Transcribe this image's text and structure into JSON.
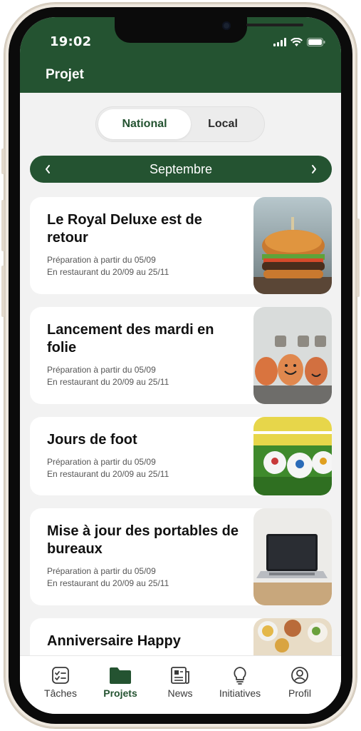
{
  "status_bar": {
    "time": "19:02"
  },
  "header": {
    "title": "Projet"
  },
  "segmented": {
    "options": [
      "National",
      "Local"
    ],
    "selected": "National"
  },
  "month_nav": {
    "label": "Septembre",
    "prev": "‹",
    "next": "›"
  },
  "projects": [
    {
      "title": "Le Royal Deluxe est de retour",
      "prep": "Préparation à partir du 05/09",
      "dates": "En restaurant du 20/09 au 25/11",
      "image": "burger-image"
    },
    {
      "title": "Lancement des mardi en folie",
      "prep": "Préparation à partir du 05/09",
      "dates": "En restaurant du 20/09 au 25/11",
      "image": "eggs-image"
    },
    {
      "title": "Jours de foot",
      "prep": "Préparation à partir du 05/09",
      "dates": "En restaurant du 20/09 au 25/11",
      "image": "footballs-image"
    },
    {
      "title": "Mise à jour des portables de bureaux",
      "prep": "Préparation à partir du 05/09",
      "dates": "En restaurant du 20/09 au 25/11",
      "image": "laptop-image"
    },
    {
      "title": "Anniversaire Happy",
      "prep": "",
      "dates": "",
      "image": "party-food-image"
    }
  ],
  "tabs": [
    {
      "label": "Tâches",
      "icon": "tasks-icon"
    },
    {
      "label": "Projets",
      "icon": "folder-icon",
      "active": true
    },
    {
      "label": "News",
      "icon": "newspaper-icon"
    },
    {
      "label": "Initiatives",
      "icon": "lightbulb-icon"
    },
    {
      "label": "Profil",
      "icon": "profile-icon"
    }
  ],
  "colors": {
    "brand": "#245331",
    "background": "#f2f2f2",
    "card": "#ffffff"
  }
}
